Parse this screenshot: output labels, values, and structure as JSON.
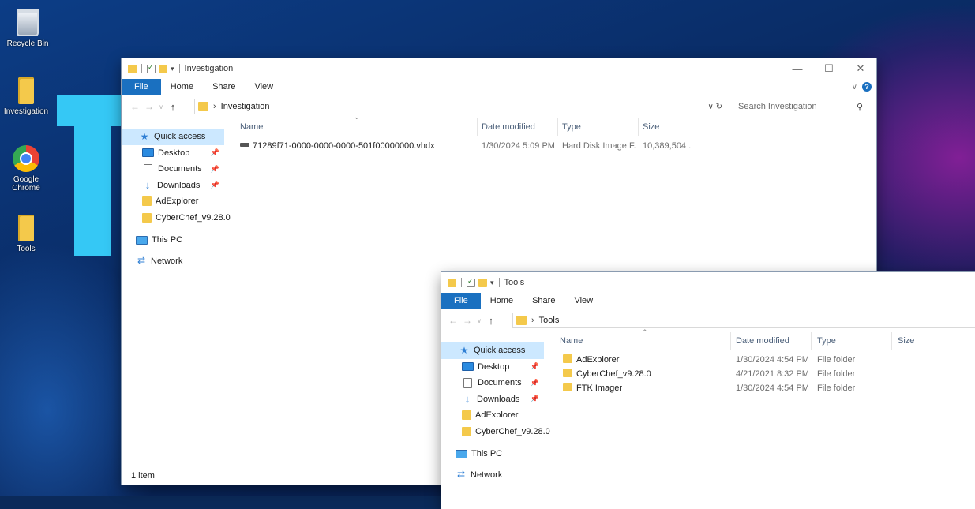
{
  "desktop": {
    "icons": [
      {
        "label": "Recycle Bin",
        "icon": "recycle-bin-icon"
      },
      {
        "label": "Investigation",
        "icon": "folder-icon"
      },
      {
        "label": "Google Chrome",
        "icon": "chrome-icon"
      },
      {
        "label": "Tools",
        "icon": "folder-icon"
      }
    ]
  },
  "win1": {
    "title": "Investigation",
    "tabs": {
      "file": "File",
      "home": "Home",
      "share": "Share",
      "view": "View"
    },
    "address": {
      "path": "Investigation",
      "search_placeholder": "Search Investigation"
    },
    "nav": {
      "quick_access": "Quick access",
      "desktop": "Desktop",
      "documents": "Documents",
      "downloads": "Downloads",
      "adexplorer": "AdExplorer",
      "cyberchef": "CyberChef_v9.28.0",
      "this_pc": "This PC",
      "network": "Network"
    },
    "columns": {
      "name": "Name",
      "date": "Date modified",
      "type": "Type",
      "size": "Size"
    },
    "files": [
      {
        "name": "71289f71-0000-0000-0000-501f00000000.vhdx",
        "date": "1/30/2024 5:09 PM",
        "type": "Hard Disk Image F...",
        "size": "10,389,504 ..."
      }
    ],
    "status": "1 item"
  },
  "win2": {
    "title": "Tools",
    "tabs": {
      "file": "File",
      "home": "Home",
      "share": "Share",
      "view": "View"
    },
    "address": {
      "path": "Tools"
    },
    "nav": {
      "quick_access": "Quick access",
      "desktop": "Desktop",
      "documents": "Documents",
      "downloads": "Downloads",
      "adexplorer": "AdExplorer",
      "cyberchef": "CyberChef_v9.28.0",
      "this_pc": "This PC",
      "network": "Network"
    },
    "columns": {
      "name": "Name",
      "date": "Date modified",
      "type": "Type",
      "size": "Size"
    },
    "files": [
      {
        "name": "AdExplorer",
        "date": "1/30/2024 4:54 PM",
        "type": "File folder"
      },
      {
        "name": "CyberChef_v9.28.0",
        "date": "4/21/2021 8:32 PM",
        "type": "File folder"
      },
      {
        "name": "FTK Imager",
        "date": "1/30/2024 4:54 PM",
        "type": "File folder"
      }
    ]
  },
  "colors": {
    "accent": "#1a70c0",
    "folder": "#f4c94b",
    "selected": "#cce8ff"
  }
}
